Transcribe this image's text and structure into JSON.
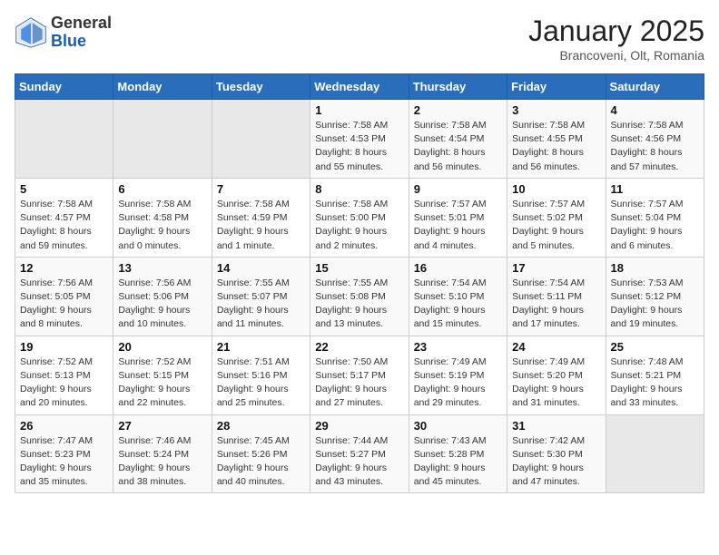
{
  "header": {
    "logo_general": "General",
    "logo_blue": "Blue",
    "month_title": "January 2025",
    "location": "Brancoveni, Olt, Romania"
  },
  "days_of_week": [
    "Sunday",
    "Monday",
    "Tuesday",
    "Wednesday",
    "Thursday",
    "Friday",
    "Saturday"
  ],
  "weeks": [
    [
      {
        "day": "",
        "empty": true
      },
      {
        "day": "",
        "empty": true
      },
      {
        "day": "",
        "empty": true
      },
      {
        "day": "1",
        "sunrise": "7:58 AM",
        "sunset": "4:53 PM",
        "daylight": "8 hours and 55 minutes."
      },
      {
        "day": "2",
        "sunrise": "7:58 AM",
        "sunset": "4:54 PM",
        "daylight": "8 hours and 56 minutes."
      },
      {
        "day": "3",
        "sunrise": "7:58 AM",
        "sunset": "4:55 PM",
        "daylight": "8 hours and 56 minutes."
      },
      {
        "day": "4",
        "sunrise": "7:58 AM",
        "sunset": "4:56 PM",
        "daylight": "8 hours and 57 minutes."
      }
    ],
    [
      {
        "day": "5",
        "sunrise": "7:58 AM",
        "sunset": "4:57 PM",
        "daylight": "8 hours and 59 minutes."
      },
      {
        "day": "6",
        "sunrise": "7:58 AM",
        "sunset": "4:58 PM",
        "daylight": "9 hours and 0 minutes."
      },
      {
        "day": "7",
        "sunrise": "7:58 AM",
        "sunset": "4:59 PM",
        "daylight": "9 hours and 1 minute."
      },
      {
        "day": "8",
        "sunrise": "7:58 AM",
        "sunset": "5:00 PM",
        "daylight": "9 hours and 2 minutes."
      },
      {
        "day": "9",
        "sunrise": "7:57 AM",
        "sunset": "5:01 PM",
        "daylight": "9 hours and 4 minutes."
      },
      {
        "day": "10",
        "sunrise": "7:57 AM",
        "sunset": "5:02 PM",
        "daylight": "9 hours and 5 minutes."
      },
      {
        "day": "11",
        "sunrise": "7:57 AM",
        "sunset": "5:04 PM",
        "daylight": "9 hours and 6 minutes."
      }
    ],
    [
      {
        "day": "12",
        "sunrise": "7:56 AM",
        "sunset": "5:05 PM",
        "daylight": "9 hours and 8 minutes."
      },
      {
        "day": "13",
        "sunrise": "7:56 AM",
        "sunset": "5:06 PM",
        "daylight": "9 hours and 10 minutes."
      },
      {
        "day": "14",
        "sunrise": "7:55 AM",
        "sunset": "5:07 PM",
        "daylight": "9 hours and 11 minutes."
      },
      {
        "day": "15",
        "sunrise": "7:55 AM",
        "sunset": "5:08 PM",
        "daylight": "9 hours and 13 minutes."
      },
      {
        "day": "16",
        "sunrise": "7:54 AM",
        "sunset": "5:10 PM",
        "daylight": "9 hours and 15 minutes."
      },
      {
        "day": "17",
        "sunrise": "7:54 AM",
        "sunset": "5:11 PM",
        "daylight": "9 hours and 17 minutes."
      },
      {
        "day": "18",
        "sunrise": "7:53 AM",
        "sunset": "5:12 PM",
        "daylight": "9 hours and 19 minutes."
      }
    ],
    [
      {
        "day": "19",
        "sunrise": "7:52 AM",
        "sunset": "5:13 PM",
        "daylight": "9 hours and 20 minutes."
      },
      {
        "day": "20",
        "sunrise": "7:52 AM",
        "sunset": "5:15 PM",
        "daylight": "9 hours and 22 minutes."
      },
      {
        "day": "21",
        "sunrise": "7:51 AM",
        "sunset": "5:16 PM",
        "daylight": "9 hours and 25 minutes."
      },
      {
        "day": "22",
        "sunrise": "7:50 AM",
        "sunset": "5:17 PM",
        "daylight": "9 hours and 27 minutes."
      },
      {
        "day": "23",
        "sunrise": "7:49 AM",
        "sunset": "5:19 PM",
        "daylight": "9 hours and 29 minutes."
      },
      {
        "day": "24",
        "sunrise": "7:49 AM",
        "sunset": "5:20 PM",
        "daylight": "9 hours and 31 minutes."
      },
      {
        "day": "25",
        "sunrise": "7:48 AM",
        "sunset": "5:21 PM",
        "daylight": "9 hours and 33 minutes."
      }
    ],
    [
      {
        "day": "26",
        "sunrise": "7:47 AM",
        "sunset": "5:23 PM",
        "daylight": "9 hours and 35 minutes."
      },
      {
        "day": "27",
        "sunrise": "7:46 AM",
        "sunset": "5:24 PM",
        "daylight": "9 hours and 38 minutes."
      },
      {
        "day": "28",
        "sunrise": "7:45 AM",
        "sunset": "5:26 PM",
        "daylight": "9 hours and 40 minutes."
      },
      {
        "day": "29",
        "sunrise": "7:44 AM",
        "sunset": "5:27 PM",
        "daylight": "9 hours and 43 minutes."
      },
      {
        "day": "30",
        "sunrise": "7:43 AM",
        "sunset": "5:28 PM",
        "daylight": "9 hours and 45 minutes."
      },
      {
        "day": "31",
        "sunrise": "7:42 AM",
        "sunset": "5:30 PM",
        "daylight": "9 hours and 47 minutes."
      },
      {
        "day": "",
        "empty": true
      }
    ]
  ]
}
